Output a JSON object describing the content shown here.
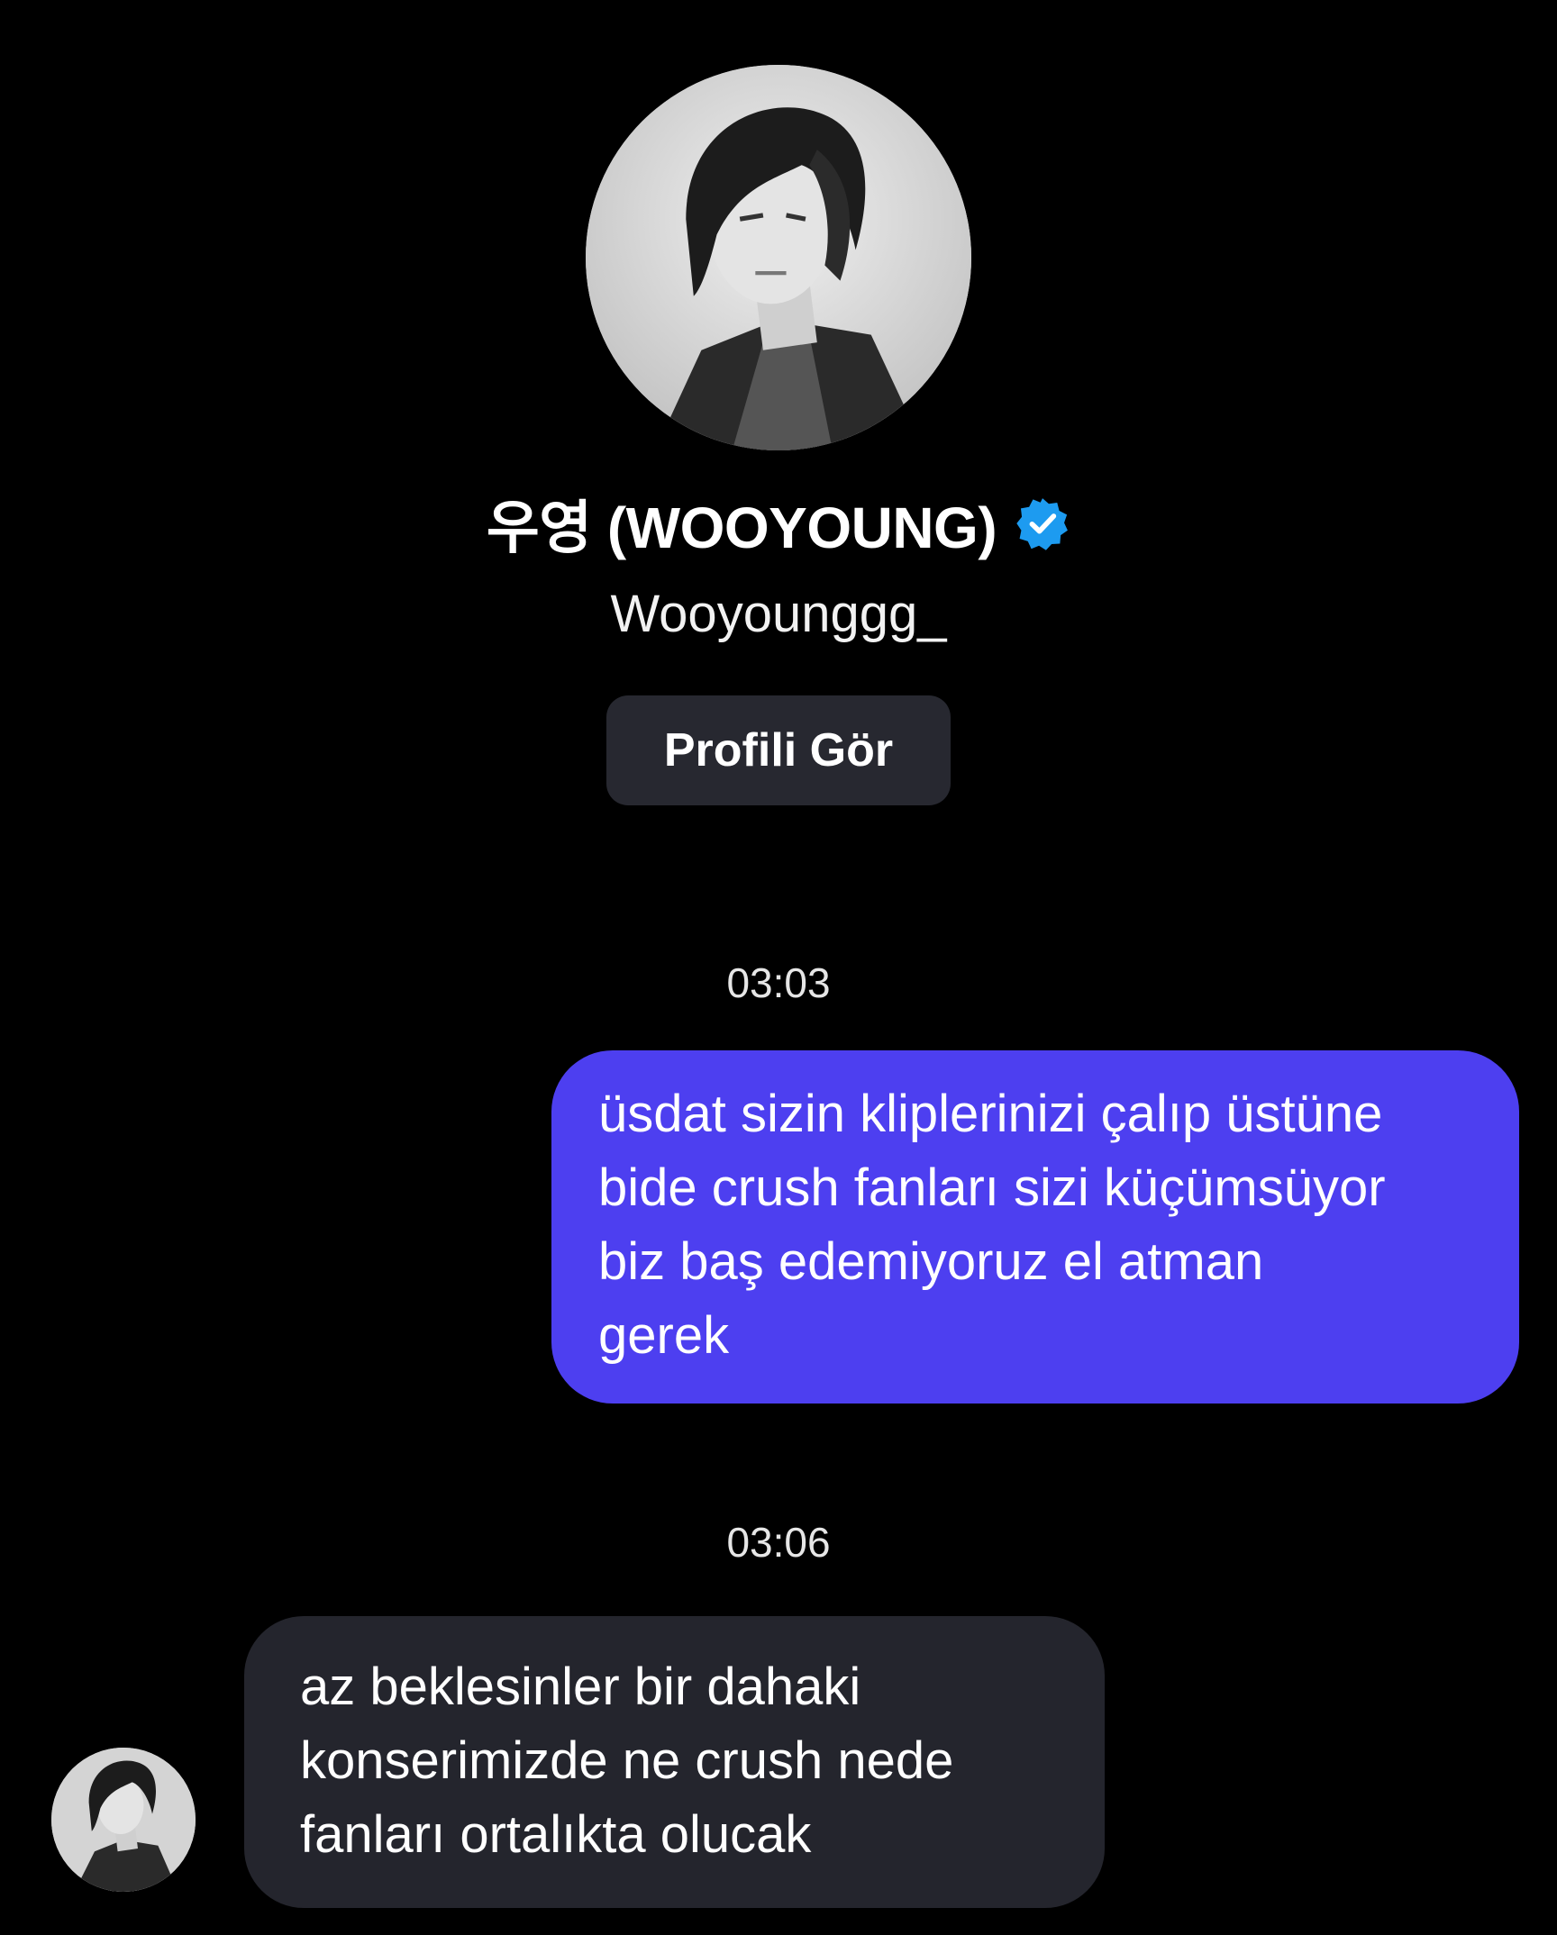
{
  "profile": {
    "display_name": "우영 (WOOYOUNG)",
    "username": "Wooyounggg_",
    "verified": true,
    "view_profile_label": "Profili Gör"
  },
  "colors": {
    "background": "#000000",
    "sent_bubble": "#4d3ff0",
    "received_bubble": "#24252d",
    "button": "#272830",
    "verified_badge": "#1d9bf0"
  },
  "icons": {
    "verified": "verified-badge-icon",
    "avatar": "profile-photo"
  },
  "messages": [
    {
      "timestamp": "03:03",
      "direction": "sent",
      "text": "üsdat sizin kliplerinizi çalıp üstüne\nbide crush fanları sizi küçümsüyor\nbiz baş edemiyoruz el atman\ngerek"
    },
    {
      "timestamp": "03:06",
      "direction": "received",
      "text": "az beklesinler bir dahaki\nkonserimizde ne crush nede\nfanları ortalıkta olucak"
    }
  ]
}
